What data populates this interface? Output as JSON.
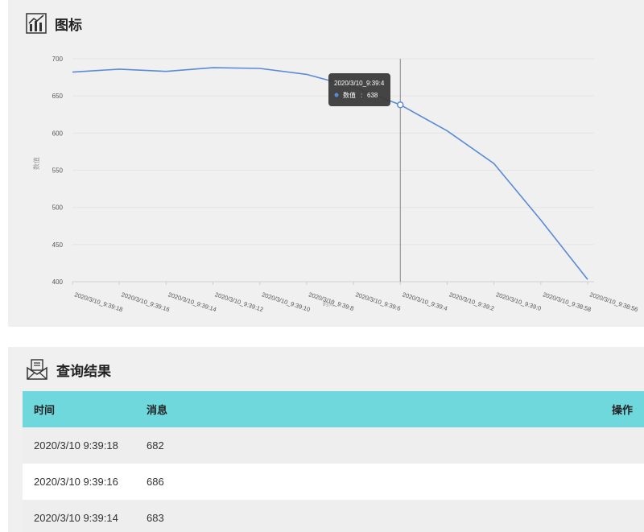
{
  "chart_panel": {
    "title": "图标"
  },
  "chart_data": {
    "type": "line",
    "x": [
      "2020/3/10_9:39:18",
      "2020/3/10_9:39:16",
      "2020/3/10_9:39:14",
      "2020/3/10_9:39:12",
      "2020/3/10_9:39:10",
      "2020/3/10_9:39:8",
      "2020/3/10_9:39:6",
      "2020/3/10_9:39:4",
      "2020/3/10_9:39:2",
      "2020/3/10_9:39:0",
      "2020/3/10_9:38:58",
      "2020/3/10_9:38:56"
    ],
    "series": [
      {
        "name": "数值",
        "values": [
          682,
          686,
          683,
          688,
          687,
          679,
          662,
          638,
          603,
          559,
          483,
          403
        ]
      }
    ],
    "ylim": [
      400,
      700
    ],
    "yticks": [
      400,
      450,
      500,
      550,
      600,
      650,
      700
    ],
    "ylabel": "数值",
    "xlabel": "时间",
    "grid": true,
    "line_color": "#5b8ad8",
    "tooltip": {
      "title": "2020/3/10_9:39:4",
      "series_name": "数值",
      "value": 638,
      "index": 7
    }
  },
  "result_panel": {
    "title": "查询结果",
    "headers": {
      "time": "时间",
      "message": "消息",
      "action": "操作"
    },
    "rows": [
      {
        "time": "2020/3/10 9:39:18",
        "message": "682"
      },
      {
        "time": "2020/3/10 9:39:16",
        "message": "686"
      },
      {
        "time": "2020/3/10 9:39:14",
        "message": "683"
      }
    ]
  },
  "colors": {
    "header_bg": "#6fd8dc",
    "panel_bg": "#f0f0f0",
    "line": "#5b8ad8"
  }
}
